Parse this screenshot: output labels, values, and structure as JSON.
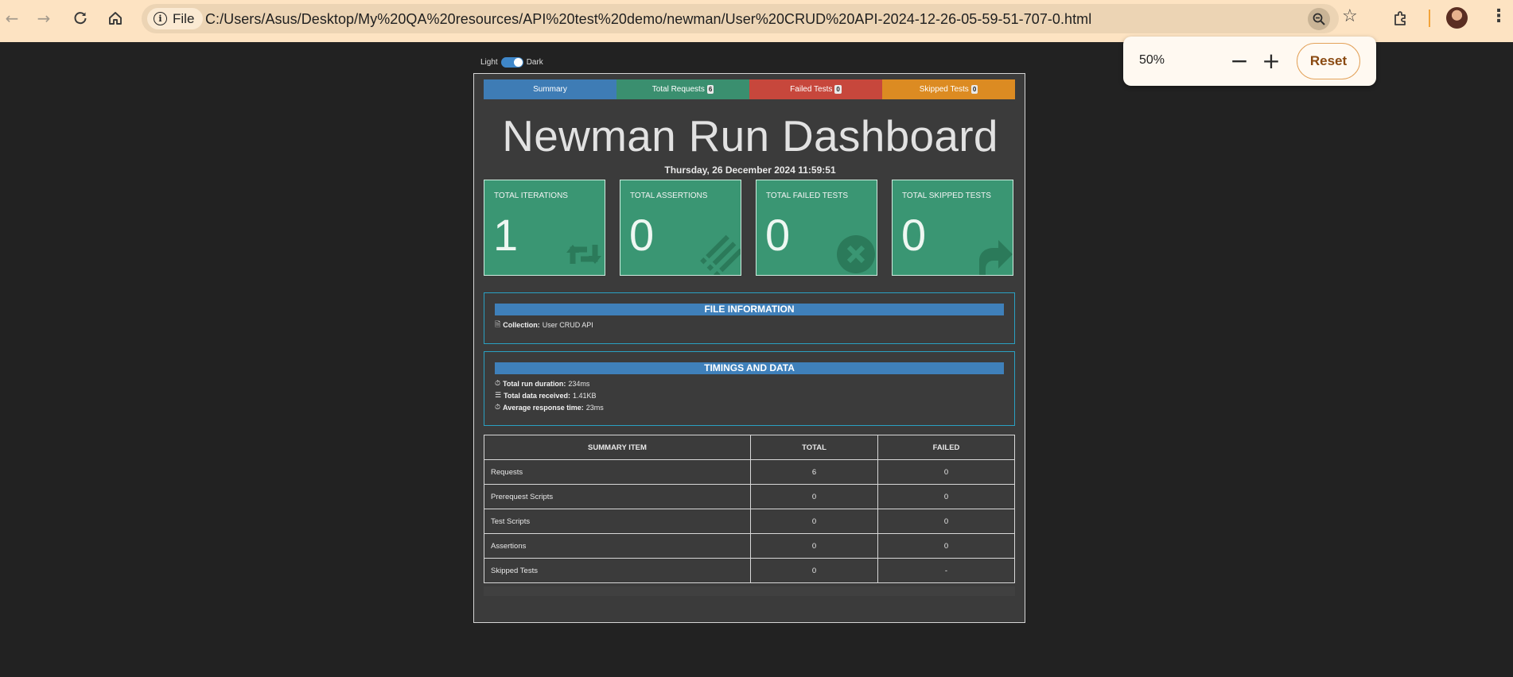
{
  "browser": {
    "site_chip_label": "File",
    "url": "C:/Users/Asus/Desktop/My%20QA%20resources/API%20test%20demo/newman/User%20CRUD%20API-2024-12-26-05-59-51-707-0.html"
  },
  "zoom_popup": {
    "level": "50%",
    "minus": "−",
    "plus": "+",
    "reset_label": "Reset"
  },
  "theme_toggle": {
    "light_label": "Light",
    "dark_label": "Dark"
  },
  "tabs": [
    {
      "label": "Summary",
      "badge": ""
    },
    {
      "label": "Total Requests",
      "badge": "6"
    },
    {
      "label": "Failed Tests",
      "badge": "0"
    },
    {
      "label": "Skipped Tests",
      "badge": "0"
    }
  ],
  "dashboard": {
    "title": "Newman Run Dashboard",
    "date": "Thursday, 26 December 2024 11:59:51"
  },
  "cards": [
    {
      "label": "TOTAL ITERATIONS",
      "value": "1",
      "icon": "retweet-icon"
    },
    {
      "label": "TOTAL ASSERTIONS",
      "value": "0",
      "icon": "list-icon"
    },
    {
      "label": "TOTAL FAILED TESTS",
      "value": "0",
      "icon": "times-circle-icon"
    },
    {
      "label": "TOTAL SKIPPED TESTS",
      "value": "0",
      "icon": "share-icon"
    }
  ],
  "file_info": {
    "heading": "FILE INFORMATION",
    "collection_label": "Collection:",
    "collection_value": "User CRUD API"
  },
  "timings": {
    "heading": "TIMINGS AND DATA",
    "rows": [
      {
        "label": "Total run duration:",
        "value": "234ms",
        "icon": "stopwatch-icon"
      },
      {
        "label": "Total data received:",
        "value": "1.41KB",
        "icon": "database-icon"
      },
      {
        "label": "Average response time:",
        "value": "23ms",
        "icon": "stopwatch-icon"
      }
    ]
  },
  "summary_table": {
    "headers": [
      "SUMMARY ITEM",
      "TOTAL",
      "FAILED"
    ],
    "rows": [
      [
        "Requests",
        "6",
        "0"
      ],
      [
        "Prerequest Scripts",
        "0",
        "0"
      ],
      [
        "Test Scripts",
        "0",
        "0"
      ],
      [
        "Assertions",
        "0",
        "0"
      ],
      [
        "Skipped Tests",
        "0",
        "-"
      ]
    ]
  }
}
